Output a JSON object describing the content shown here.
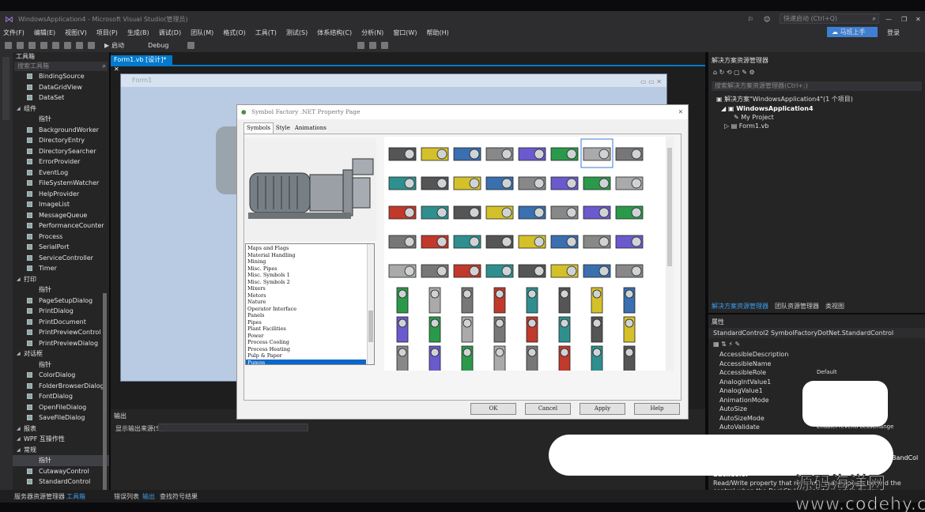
{
  "window": {
    "title": "WindowsApplication4 - Microsoft Visual Studio(管理员)",
    "quick_launch": "快速启动 (Ctrl+Q)",
    "signin": "登录",
    "share": "马班上手"
  },
  "menu": [
    "文件(F)",
    "编辑(E)",
    "视图(V)",
    "项目(P)",
    "生成(B)",
    "调试(D)",
    "团队(M)",
    "格式(O)",
    "工具(T)",
    "测试(S)",
    "体系结构(C)",
    "分析(N)",
    "窗口(W)",
    "帮助(H)"
  ],
  "toolbar": {
    "start": "启动",
    "config": "Debug"
  },
  "toolbox": {
    "title": "工具箱",
    "search": "搜索工具箱",
    "items": [
      {
        "t": "i",
        "l": "BindingSource"
      },
      {
        "t": "i",
        "l": "DataGridView"
      },
      {
        "t": "i",
        "l": "DataSet"
      },
      {
        "t": "g",
        "l": "组件"
      },
      {
        "t": "i",
        "l": "指针"
      },
      {
        "t": "i",
        "l": "BackgroundWorker"
      },
      {
        "t": "i",
        "l": "DirectoryEntry"
      },
      {
        "t": "i",
        "l": "DirectorySearcher"
      },
      {
        "t": "i",
        "l": "ErrorProvider"
      },
      {
        "t": "i",
        "l": "EventLog"
      },
      {
        "t": "i",
        "l": "FileSystemWatcher"
      },
      {
        "t": "i",
        "l": "HelpProvider"
      },
      {
        "t": "i",
        "l": "ImageList"
      },
      {
        "t": "i",
        "l": "MessageQueue"
      },
      {
        "t": "i",
        "l": "PerformanceCounter"
      },
      {
        "t": "i",
        "l": "Process"
      },
      {
        "t": "i",
        "l": "SerialPort"
      },
      {
        "t": "i",
        "l": "ServiceController"
      },
      {
        "t": "i",
        "l": "Timer"
      },
      {
        "t": "g",
        "l": "打印"
      },
      {
        "t": "i",
        "l": "指针"
      },
      {
        "t": "i",
        "l": "PageSetupDialog"
      },
      {
        "t": "i",
        "l": "PrintDialog"
      },
      {
        "t": "i",
        "l": "PrintDocument"
      },
      {
        "t": "i",
        "l": "PrintPreviewControl"
      },
      {
        "t": "i",
        "l": "PrintPreviewDialog"
      },
      {
        "t": "g",
        "l": "对话框"
      },
      {
        "t": "i",
        "l": "指针"
      },
      {
        "t": "i",
        "l": "ColorDialog"
      },
      {
        "t": "i",
        "l": "FolderBrowserDialog"
      },
      {
        "t": "i",
        "l": "FontDialog"
      },
      {
        "t": "i",
        "l": "OpenFileDialog"
      },
      {
        "t": "i",
        "l": "SaveFileDialog"
      },
      {
        "t": "g",
        "l": "报表"
      },
      {
        "t": "g",
        "l": "WPF 互操作性"
      },
      {
        "t": "g",
        "l": "常规"
      },
      {
        "t": "i",
        "l": "指针"
      },
      {
        "t": "i",
        "l": "CutawayControl"
      },
      {
        "t": "i",
        "l": "StandardControl"
      }
    ]
  },
  "editor": {
    "tab": "Form1.vb [设计]*",
    "form_title": "Form1"
  },
  "output": {
    "title": "输出",
    "source_label": "显示输出来源(S):"
  },
  "solution": {
    "title": "解决方案资源管理器",
    "search": "搜索解决方案资源管理器(Ctrl+;)",
    "root": "解决方案\"WindowsApplication4\"(1 个项目)",
    "project": "WindowsApplication4",
    "items": [
      "My Project",
      "Form1.vb"
    ],
    "tabs": [
      "解决方案资源管理器",
      "团队资源管理器",
      "类视图"
    ]
  },
  "properties": {
    "title": "属性",
    "object": "StandardControl2 SymbolFactoryDotNet.StandardControl",
    "rows": [
      {
        "n": "AccessibleDescription",
        "v": ""
      },
      {
        "n": "AccessibleName",
        "v": ""
      },
      {
        "n": "AccessibleRole",
        "v": "Default"
      },
      {
        "n": "AnalogIntValue1",
        "v": ""
      },
      {
        "n": "AnalogValue1",
        "v": ""
      },
      {
        "n": "AnimationMode",
        "v": ""
      },
      {
        "n": "AutoSize",
        "v": ""
      },
      {
        "n": "AutoSizeMode",
        "v": ""
      },
      {
        "n": "AutoValidate",
        "v": "EnablePreventFocusChange"
      }
    ],
    "desc_title": "BackColor",
    "desc": "Read/Write property that returns... that appears behind the control when the BackStyle property is set to Opaque",
    "partial": "BandCol"
  },
  "dialog": {
    "title": "Symbol Factory .NET Property Page",
    "tabs": [
      "Symbols",
      "Style",
      "Animations"
    ],
    "categories": [
      "Maps and Flags",
      "Material Handling",
      "Mining",
      "Misc. Pipes",
      "Misc. Symbols 1",
      "Misc. Symbols 2",
      "Mixers",
      "Motors",
      "Nature",
      "Operator Interface",
      "Panels",
      "Pipes",
      "Plant Facilities",
      "Power",
      "Process Cooling",
      "Process Heating",
      "Pulp & Paper",
      "Pumps"
    ],
    "selected": "Pumps",
    "buttons": [
      "OK",
      "Cancel",
      "Apply",
      "Help"
    ]
  },
  "status": {
    "tabs": [
      "服务器资源管理器",
      "工具箱"
    ],
    "output_tabs": [
      "错误列表",
      "输出",
      "查找符号结果"
    ]
  },
  "watermark": "源码海洋网 www.codehy.com",
  "colors": {
    "vs_dark": "#2d2d30",
    "panel": "#252526",
    "accent": "#007acc",
    "dialog": "#f0f0f0",
    "designer": "#b9cbe2"
  }
}
